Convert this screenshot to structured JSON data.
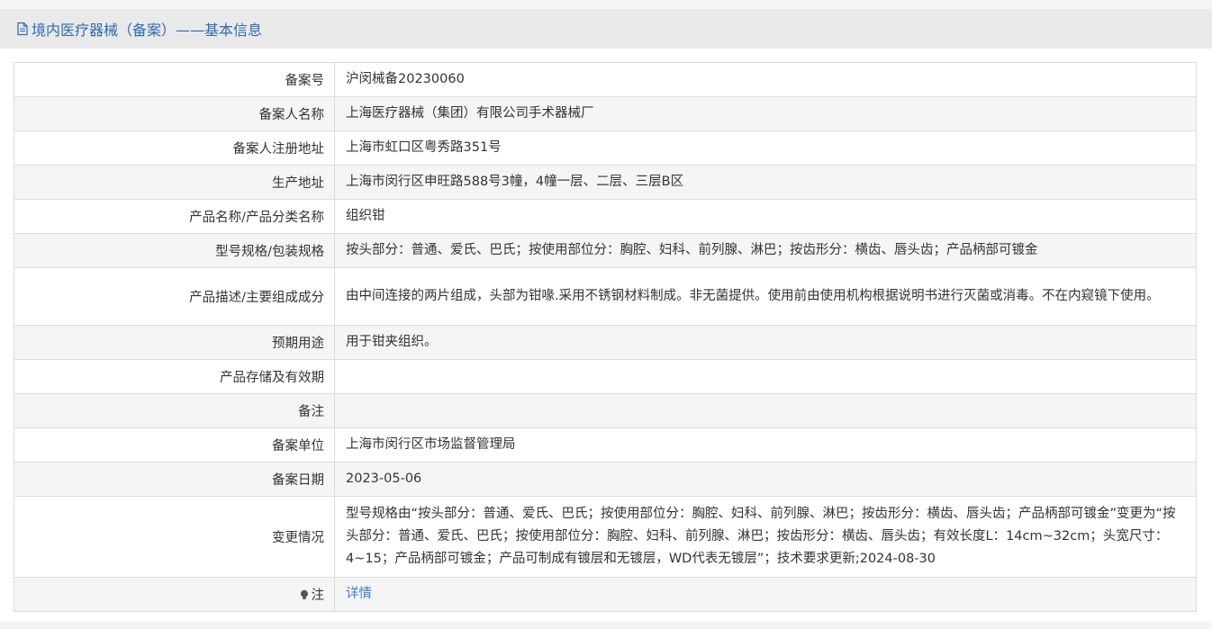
{
  "header": {
    "title": "境内医疗器械（备案）——基本信息",
    "icon": "document-icon"
  },
  "rows": [
    {
      "label": "备案号",
      "value": "沪闵械备20230060"
    },
    {
      "label": "备案人名称",
      "value": "上海医疗器械（集团）有限公司手术器械厂"
    },
    {
      "label": "备案人注册地址",
      "value": "上海市虹口区粤秀路351号"
    },
    {
      "label": "生产地址",
      "value": "上海市闵行区申旺路588号3幢，4幢一层、二层、三层B区"
    },
    {
      "label": "产品名称/产品分类名称",
      "value": "组织钳"
    },
    {
      "label": "型号规格/包装规格",
      "value": "按头部分：普通、爱氏、巴氏；按使用部位分：胸腔、妇科、前列腺、淋巴；按齿形分：横齿、唇头齿；产品柄部可镀金"
    },
    {
      "label": "产品描述/主要组成成分",
      "value": "由中间连接的两片组成，头部为钳喙.采用不锈钢材料制成。非无菌提供。使用前由使用机构根据说明书进行灭菌或消毒。不在内窥镜下使用。"
    },
    {
      "label": "预期用途",
      "value": "用于钳夹组织。"
    },
    {
      "label": "产品存储及有效期",
      "value": ""
    },
    {
      "label": "备注",
      "value": ""
    },
    {
      "label": "备案单位",
      "value": "上海市闵行区市场监督管理局"
    },
    {
      "label": "备案日期",
      "value": "2023-05-06"
    },
    {
      "label": "变更情况",
      "value": "型号规格由“按头部分：普通、爱氏、巴氏；按使用部位分：胸腔、妇科、前列腺、淋巴；按齿形分：横齿、唇头齿；产品柄部可镀金”变更为“按头部分：普通、爱氏、巴氏；按使用部位分：胸腔、妇科、前列腺、淋巴；按齿形分：横齿、唇头齿；有效长度L：14cm~32cm；头宽尺寸：4~15；产品柄部可镀金；产品可制成有镀层和无镀层，WD代表无镀层”；技术要求更新;2024-08-30"
    }
  ],
  "note": {
    "label": "注",
    "icon": "lightbulb-icon",
    "link_text": "详情"
  },
  "colors": {
    "header_bg": "#e9e9e9",
    "header_text": "#2b6cb0",
    "row_alt_bg": "#f5f5f5",
    "border": "#dcdcdc",
    "link": "#3a7bd5"
  }
}
